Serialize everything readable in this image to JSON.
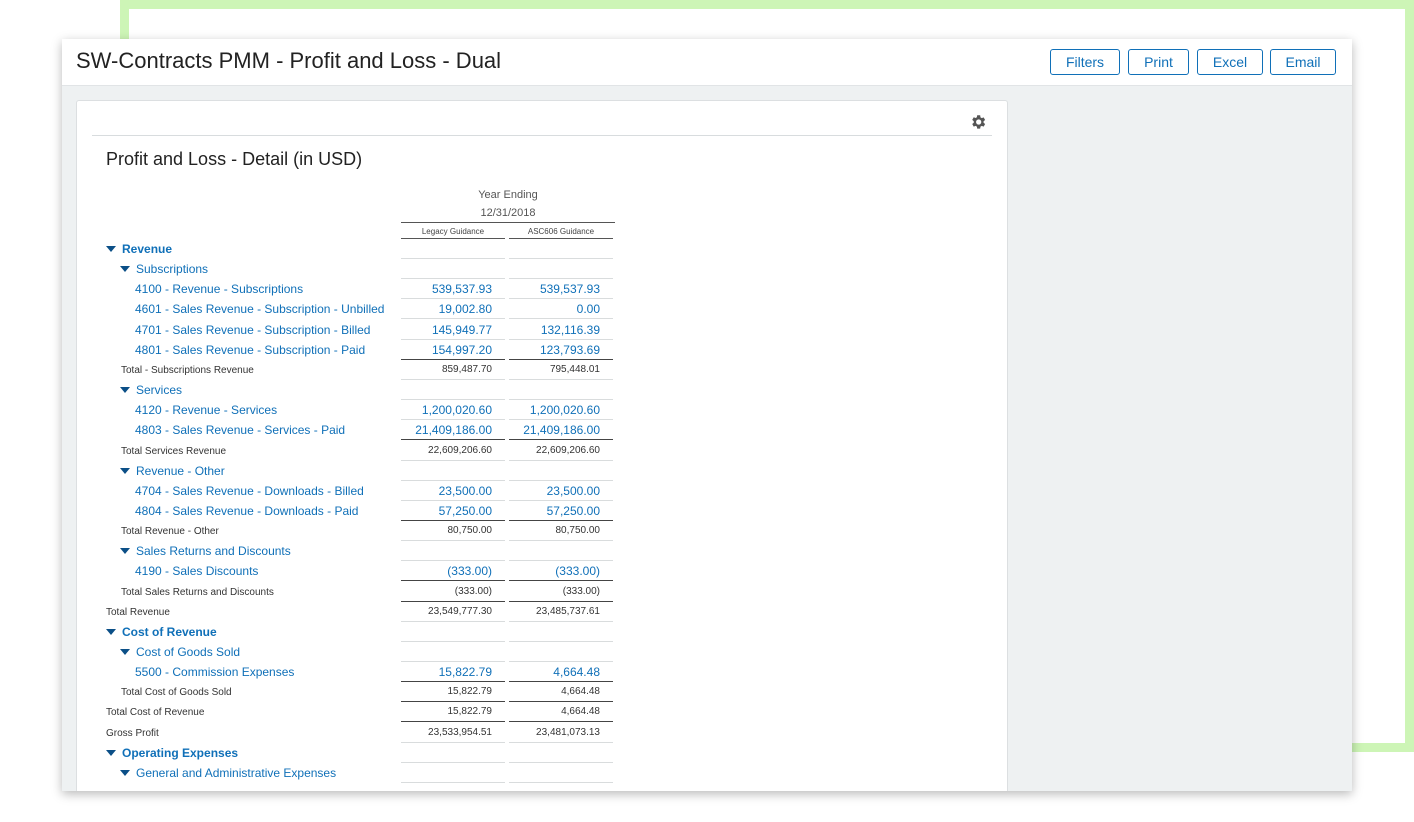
{
  "window": {
    "title": "SW-Contracts PMM - Profit and Loss - Dual",
    "buttons": {
      "filters": "Filters",
      "print": "Print",
      "excel": "Excel",
      "email": "Email"
    }
  },
  "report": {
    "title": "Profit and Loss - Detail (in USD)",
    "period_label": "Year Ending",
    "period_date": "12/31/2018",
    "columns": [
      "Legacy Guidance",
      "ASC606 Guidance"
    ],
    "rows": [
      {
        "type": "section",
        "label": "Revenue"
      },
      {
        "type": "group",
        "label": "Subscriptions"
      },
      {
        "type": "account",
        "label": "4100 - Revenue - Subscriptions",
        "v1": "539,537.93",
        "v2": "539,537.93"
      },
      {
        "type": "account",
        "label": "4601 - Sales Revenue - Subscription - Unbilled",
        "v1": "19,002.80",
        "v2": "0.00"
      },
      {
        "type": "account",
        "label": "4701 - Sales Revenue - Subscription - Billed",
        "v1": "145,949.77",
        "v2": "132,116.39"
      },
      {
        "type": "account",
        "label": "4801 - Sales Revenue - Subscription - Paid",
        "v1": "154,997.20",
        "v2": "123,793.69"
      },
      {
        "type": "total",
        "indent": 1,
        "label": "Total - Subscriptions Revenue",
        "v1": "859,487.70",
        "v2": "795,448.01"
      },
      {
        "type": "group",
        "label": "Services"
      },
      {
        "type": "account",
        "label": "4120 - Revenue - Services",
        "v1": "1,200,020.60",
        "v2": "1,200,020.60"
      },
      {
        "type": "account",
        "label": "4803 - Sales Revenue - Services - Paid",
        "v1": "21,409,186.00",
        "v2": "21,409,186.00"
      },
      {
        "type": "total",
        "indent": 1,
        "label": "Total Services Revenue",
        "v1": "22,609,206.60",
        "v2": "22,609,206.60"
      },
      {
        "type": "group",
        "label": "Revenue - Other"
      },
      {
        "type": "account",
        "label": "4704 - Sales Revenue - Downloads - Billed",
        "v1": "23,500.00",
        "v2": "23,500.00"
      },
      {
        "type": "account",
        "label": "4804 - Sales Revenue - Downloads - Paid",
        "v1": "57,250.00",
        "v2": "57,250.00"
      },
      {
        "type": "total",
        "indent": 1,
        "label": "Total Revenue - Other",
        "v1": "80,750.00",
        "v2": "80,750.00"
      },
      {
        "type": "group",
        "label": "Sales Returns and Discounts"
      },
      {
        "type": "account",
        "label": "4190 - Sales Discounts",
        "v1": "(333.00)",
        "v2": "(333.00)"
      },
      {
        "type": "total",
        "indent": 1,
        "label": "Total Sales Returns and Discounts",
        "v1": "(333.00)",
        "v2": "(333.00)"
      },
      {
        "type": "total",
        "indent": 0,
        "label": "Total Revenue",
        "v1": "23,549,777.30",
        "v2": "23,485,737.61"
      },
      {
        "type": "section",
        "label": "Cost of Revenue"
      },
      {
        "type": "group",
        "label": "Cost of Goods Sold"
      },
      {
        "type": "account",
        "label": "5500 - Commission Expenses",
        "v1": "15,822.79",
        "v2": "4,664.48"
      },
      {
        "type": "total",
        "indent": 1,
        "label": "Total Cost of Goods Sold",
        "v1": "15,822.79",
        "v2": "4,664.48"
      },
      {
        "type": "total",
        "indent": 0,
        "label": "Total Cost of Revenue",
        "v1": "15,822.79",
        "v2": "4,664.48"
      },
      {
        "type": "total",
        "indent": 0,
        "label": "Gross Profit",
        "v1": "23,533,954.51",
        "v2": "23,481,073.13"
      },
      {
        "type": "section",
        "label": "Operating Expenses"
      },
      {
        "type": "group",
        "label": "General and Administrative Expenses"
      }
    ]
  }
}
